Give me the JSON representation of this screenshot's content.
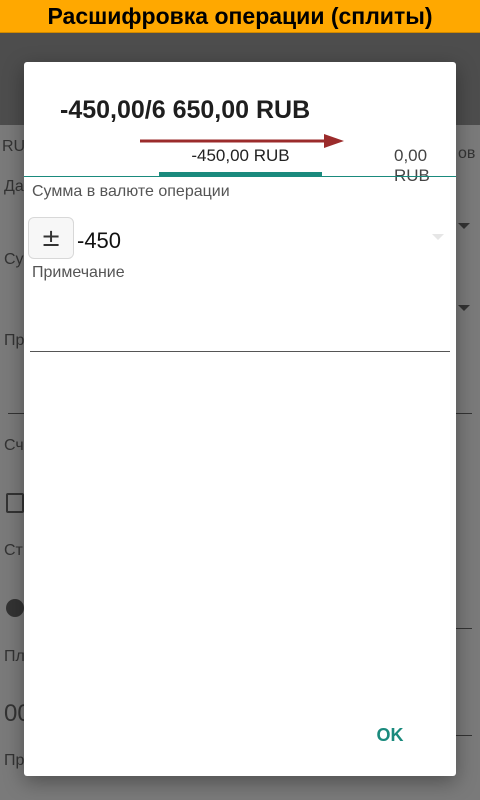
{
  "banner": {
    "title": "Расшифровка операции (сплиты)"
  },
  "background": {
    "texts": [
      "RU",
      "Да",
      "Су",
      "Пр",
      "Сч",
      "Ст",
      "Пл",
      "00",
      "Пр",
      "ов"
    ]
  },
  "dialog": {
    "title": "-450,00/6 650,00 RUB",
    "tabs": [
      {
        "label": "-450,00 RUB",
        "active": true
      },
      {
        "label": "0,00 RUB",
        "active": false
      }
    ],
    "amount_label": "Сумма в валюте операции",
    "sign_button": "±",
    "amount_value": "-450",
    "note_label": "Примечание",
    "note_value": "",
    "ok_label": "OK"
  },
  "colors": {
    "accent": "#1a8a7d",
    "banner": "#ffa800",
    "arrow": "#9b2b2b"
  },
  "icons": [
    "arrow-right-icon",
    "dropdown-icon"
  ]
}
